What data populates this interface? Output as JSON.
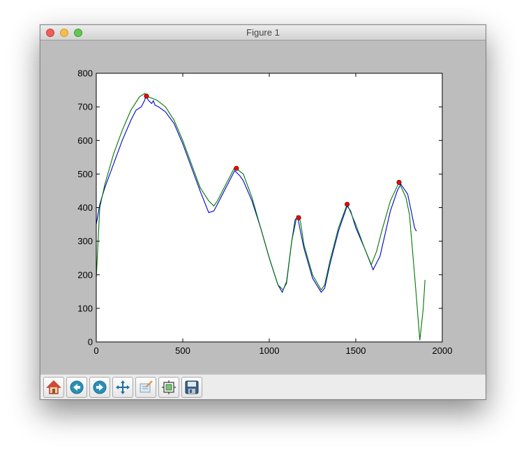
{
  "window": {
    "title": "Figure 1"
  },
  "toolbar": {
    "buttons": [
      {
        "name": "home-button",
        "icon": "home-icon"
      },
      {
        "name": "back-button",
        "icon": "back-arrow-icon"
      },
      {
        "name": "forward-button",
        "icon": "forward-arrow-icon"
      },
      {
        "name": "pan-button",
        "icon": "move-icon"
      },
      {
        "name": "zoom-button",
        "icon": "zoom-rect-icon"
      },
      {
        "name": "subplots-button",
        "icon": "configure-subplots-icon"
      },
      {
        "name": "save-button",
        "icon": "floppy-disk-icon"
      }
    ]
  },
  "chart_data": {
    "type": "line",
    "title": "",
    "xlabel": "",
    "ylabel": "",
    "xlim": [
      0,
      2000
    ],
    "ylim": [
      0,
      800
    ],
    "xticks": [
      "0",
      "500",
      "1000",
      "1500",
      "2000"
    ],
    "yticks": [
      "0",
      "100",
      "200",
      "300",
      "400",
      "500",
      "600",
      "700",
      "800"
    ],
    "grid": false,
    "series": [
      {
        "color": "#0000cc",
        "type": "line",
        "x": [
          0,
          20,
          50,
          100,
          150,
          200,
          230,
          260,
          280,
          290,
          300,
          320,
          330,
          340,
          360,
          400,
          450,
          500,
          550,
          600,
          650,
          680,
          700,
          750,
          800,
          830,
          850,
          900,
          950,
          1000,
          1050,
          1075,
          1100,
          1130,
          1150,
          1165,
          1180,
          1200,
          1250,
          1300,
          1320,
          1350,
          1400,
          1450,
          1470,
          1500,
          1550,
          1600,
          1640,
          1700,
          1740,
          1760,
          1800,
          1820,
          1840,
          1850
        ],
        "y": [
          350,
          410,
          460,
          530,
          600,
          660,
          690,
          700,
          720,
          735,
          720,
          710,
          718,
          705,
          700,
          685,
          650,
          590,
          520,
          450,
          385,
          390,
          410,
          460,
          510,
          495,
          480,
          420,
          340,
          250,
          170,
          148,
          180,
          300,
          365,
          370,
          330,
          280,
          190,
          148,
          160,
          230,
          330,
          405,
          390,
          340,
          280,
          215,
          255,
          390,
          450,
          470,
          440,
          390,
          340,
          330
        ]
      },
      {
        "color": "#007700",
        "type": "line",
        "x": [
          0,
          20,
          50,
          100,
          150,
          200,
          250,
          280,
          300,
          350,
          400,
          450,
          500,
          550,
          600,
          650,
          680,
          700,
          750,
          800,
          850,
          900,
          950,
          1000,
          1050,
          1080,
          1100,
          1130,
          1160,
          1180,
          1200,
          1250,
          1300,
          1320,
          1350,
          1400,
          1450,
          1500,
          1550,
          1590,
          1620,
          1650,
          1700,
          1750,
          1790,
          1810,
          1840,
          1870,
          1890,
          1900
        ],
        "y": [
          190,
          400,
          470,
          560,
          630,
          690,
          730,
          740,
          730,
          720,
          700,
          660,
          600,
          530,
          460,
          420,
          405,
          420,
          470,
          520,
          500,
          430,
          340,
          250,
          170,
          155,
          175,
          300,
          375,
          360,
          290,
          200,
          155,
          170,
          240,
          340,
          410,
          350,
          280,
          230,
          270,
          330,
          420,
          475,
          430,
          380,
          200,
          5,
          100,
          185
        ]
      },
      {
        "color": "#ff0000",
        "type": "scatter",
        "x": [
          290,
          810,
          1170,
          1450,
          1750
        ],
        "y": [
          732,
          517,
          370,
          410,
          475
        ]
      }
    ]
  }
}
